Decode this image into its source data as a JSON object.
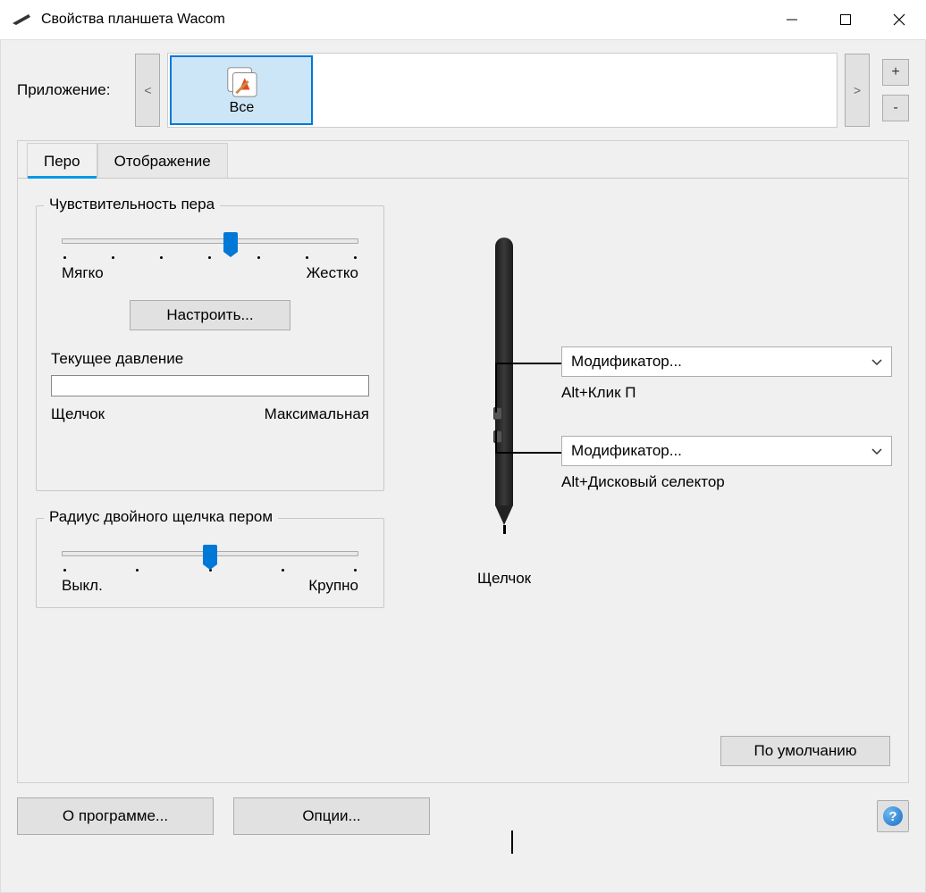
{
  "window": {
    "title": "Свойства планшета Wacom"
  },
  "appRow": {
    "label": "Приложение:",
    "scrollLeft": "<",
    "scrollRight": ">",
    "plus": "+",
    "minus": "-",
    "selected": {
      "label": "Все"
    }
  },
  "tabs": {
    "pen": "Перо",
    "mapping": "Отображение"
  },
  "tipFeel": {
    "title": "Чувствительность пера",
    "soft": "Мягко",
    "firm": "Жестко",
    "customize": "Настроить...",
    "pressureLabel": "Текущее давление",
    "click": "Щелчок",
    "max": "Максимальная",
    "sliderPercent": 57
  },
  "doubleClick": {
    "title": "Радиус двойного щелчка пером",
    "off": "Выкл.",
    "large": "Крупно",
    "sliderPercent": 50
  },
  "penDiagram": {
    "tipLabel": "Щелчок",
    "upper": {
      "dropdown": "Модификатор...",
      "sub": "Alt+Клик П"
    },
    "lower": {
      "dropdown": "Модификатор...",
      "sub": "Alt+Дисковый селектор"
    }
  },
  "defaultBtn": "По умолчанию",
  "footer": {
    "about": "О программе...",
    "options": "Опции..."
  }
}
